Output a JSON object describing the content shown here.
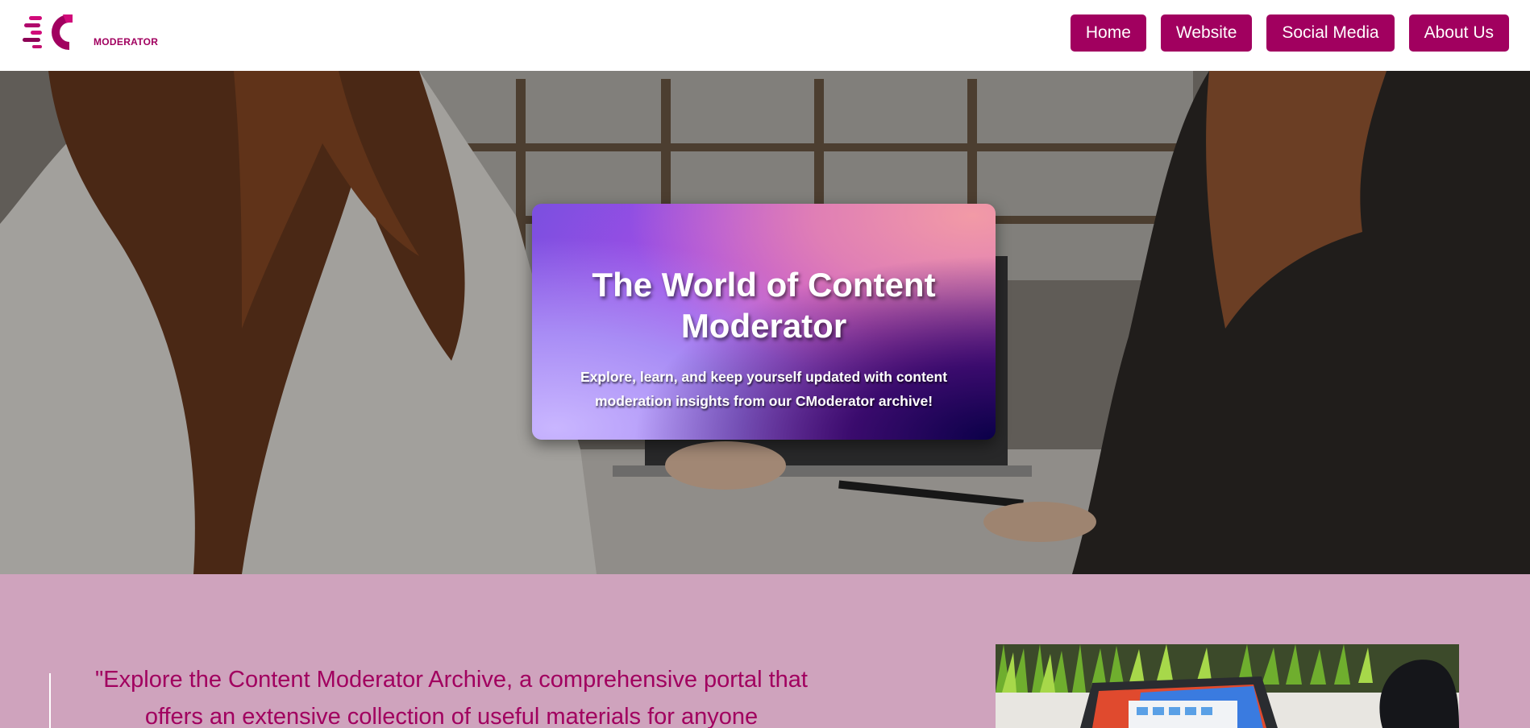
{
  "brand": {
    "logo_text": "MODERATOR",
    "accent_color": "#a1005f"
  },
  "nav": {
    "items": [
      {
        "label": "Home"
      },
      {
        "label": "Website"
      },
      {
        "label": "Social Media"
      },
      {
        "label": "About Us"
      }
    ]
  },
  "hero": {
    "title": "The World of Content Moderator",
    "subtitle": "Explore, learn, and keep yourself updated with content moderation insights from our CModerator archive!"
  },
  "about": {
    "quote": "\"Explore the Content Moderator Archive, a comprehensive portal that offers an extensive collection of useful materials for anyone",
    "background_color": "#cfa3bd"
  }
}
